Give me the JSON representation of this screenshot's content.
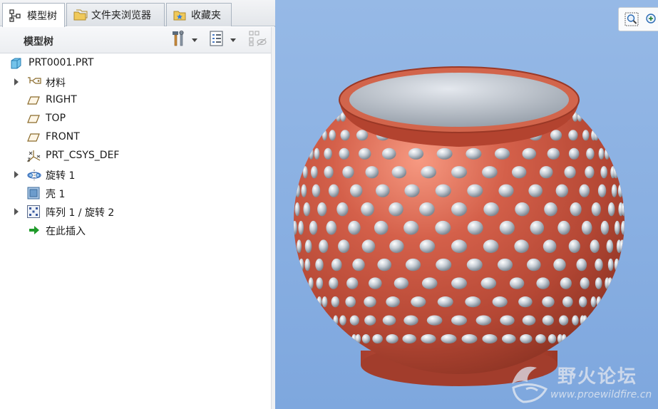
{
  "tabs": [
    {
      "label": "模型树",
      "icon": "model-tree-icon",
      "active": true
    },
    {
      "label": "文件夹浏览器",
      "icon": "folder-browser-icon",
      "active": false
    },
    {
      "label": "收藏夹",
      "icon": "favorites-icon",
      "active": false
    }
  ],
  "panel": {
    "title": "模型树"
  },
  "tree": {
    "items": [
      {
        "label": "PRT0001.PRT",
        "icon": "part-icon",
        "expandable": false
      },
      {
        "label": "材料",
        "icon": "material-icon",
        "expandable": true
      },
      {
        "label": "RIGHT",
        "icon": "datum-plane-icon",
        "expandable": false
      },
      {
        "label": "TOP",
        "icon": "datum-plane-icon",
        "expandable": false
      },
      {
        "label": "FRONT",
        "icon": "datum-plane-icon",
        "expandable": false
      },
      {
        "label": "PRT_CSYS_DEF",
        "icon": "coordinate-system-icon",
        "expandable": false
      },
      {
        "label": "旋转 1",
        "icon": "revolve-icon",
        "expandable": true
      },
      {
        "label": "壳 1",
        "icon": "shell-icon",
        "expandable": false
      },
      {
        "label": "阵列 1 / 旋转 2",
        "icon": "pattern-icon",
        "expandable": true
      },
      {
        "label": "在此插入",
        "icon": "insert-here-arrow-icon",
        "expandable": false
      }
    ]
  },
  "watermark": {
    "title": "野火论坛",
    "url": "www.proewildfire.cn"
  },
  "colors": {
    "viewport_bg": "#8fb4e4",
    "model_body": "#c0503a",
    "bumps": "#c9d0d8",
    "tree_bg": "#ffffff"
  }
}
